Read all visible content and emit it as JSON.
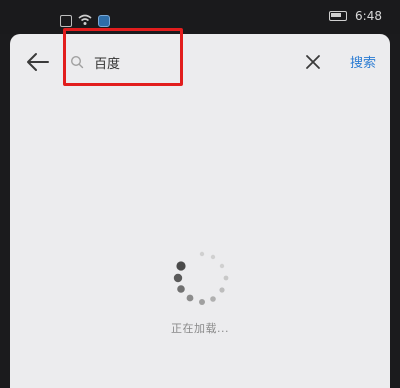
{
  "status_bar": {
    "time": "6:48",
    "icons": [
      "sim-icon",
      "wifi-icon",
      "app-icon",
      "battery-icon"
    ]
  },
  "header": {
    "search_value": "百度",
    "search_action_label": "搜索"
  },
  "content": {
    "loading_text": "正在加载..."
  },
  "colors": {
    "accent": "#2b7cd3",
    "highlight_box": "#e21d1d",
    "panel_background": "#ececee"
  }
}
